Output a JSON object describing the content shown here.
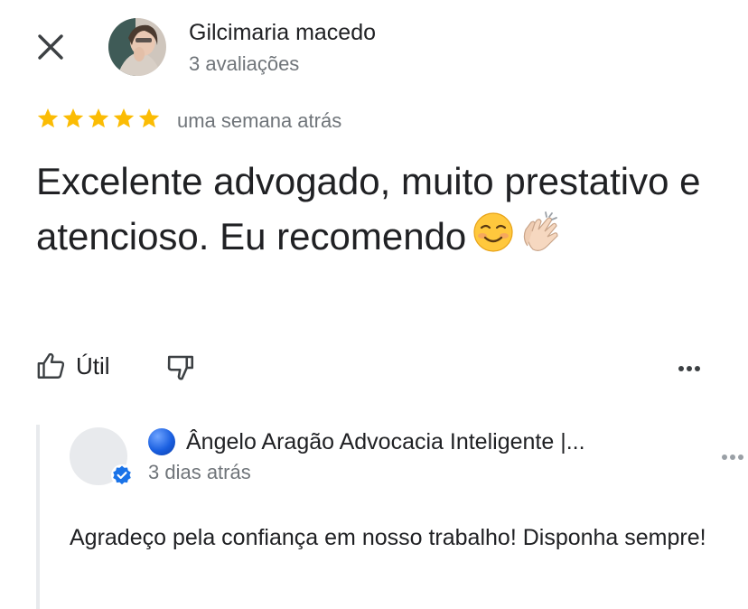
{
  "reviewer": {
    "name": "Gilcimaria macedo",
    "review_count": "3 avaliações"
  },
  "review": {
    "rating": 5,
    "rating_max": 5,
    "time": "uma semana atrás",
    "text": "Excelente advogado, muito prestativo e atencioso. Eu recomendo",
    "emojis": [
      "☺️",
      "👏🏻"
    ]
  },
  "actions": {
    "useful_label": "Útil"
  },
  "owner_reply": {
    "name": "Ângelo Aragão Advocacia Inteligente |...",
    "time": "3 dias atrás",
    "text": "Agradeço pela confiança em nosso trabalho! Disponha sempre!"
  },
  "colors": {
    "star": "#fbbc04",
    "secondary_text": "#70757a",
    "verified": "#1a73e8"
  },
  "icons": [
    "close-icon",
    "thumbs-up-icon",
    "thumbs-down-icon",
    "more-vert-icon",
    "verified-badge-icon",
    "blue-circle-emoji"
  ]
}
